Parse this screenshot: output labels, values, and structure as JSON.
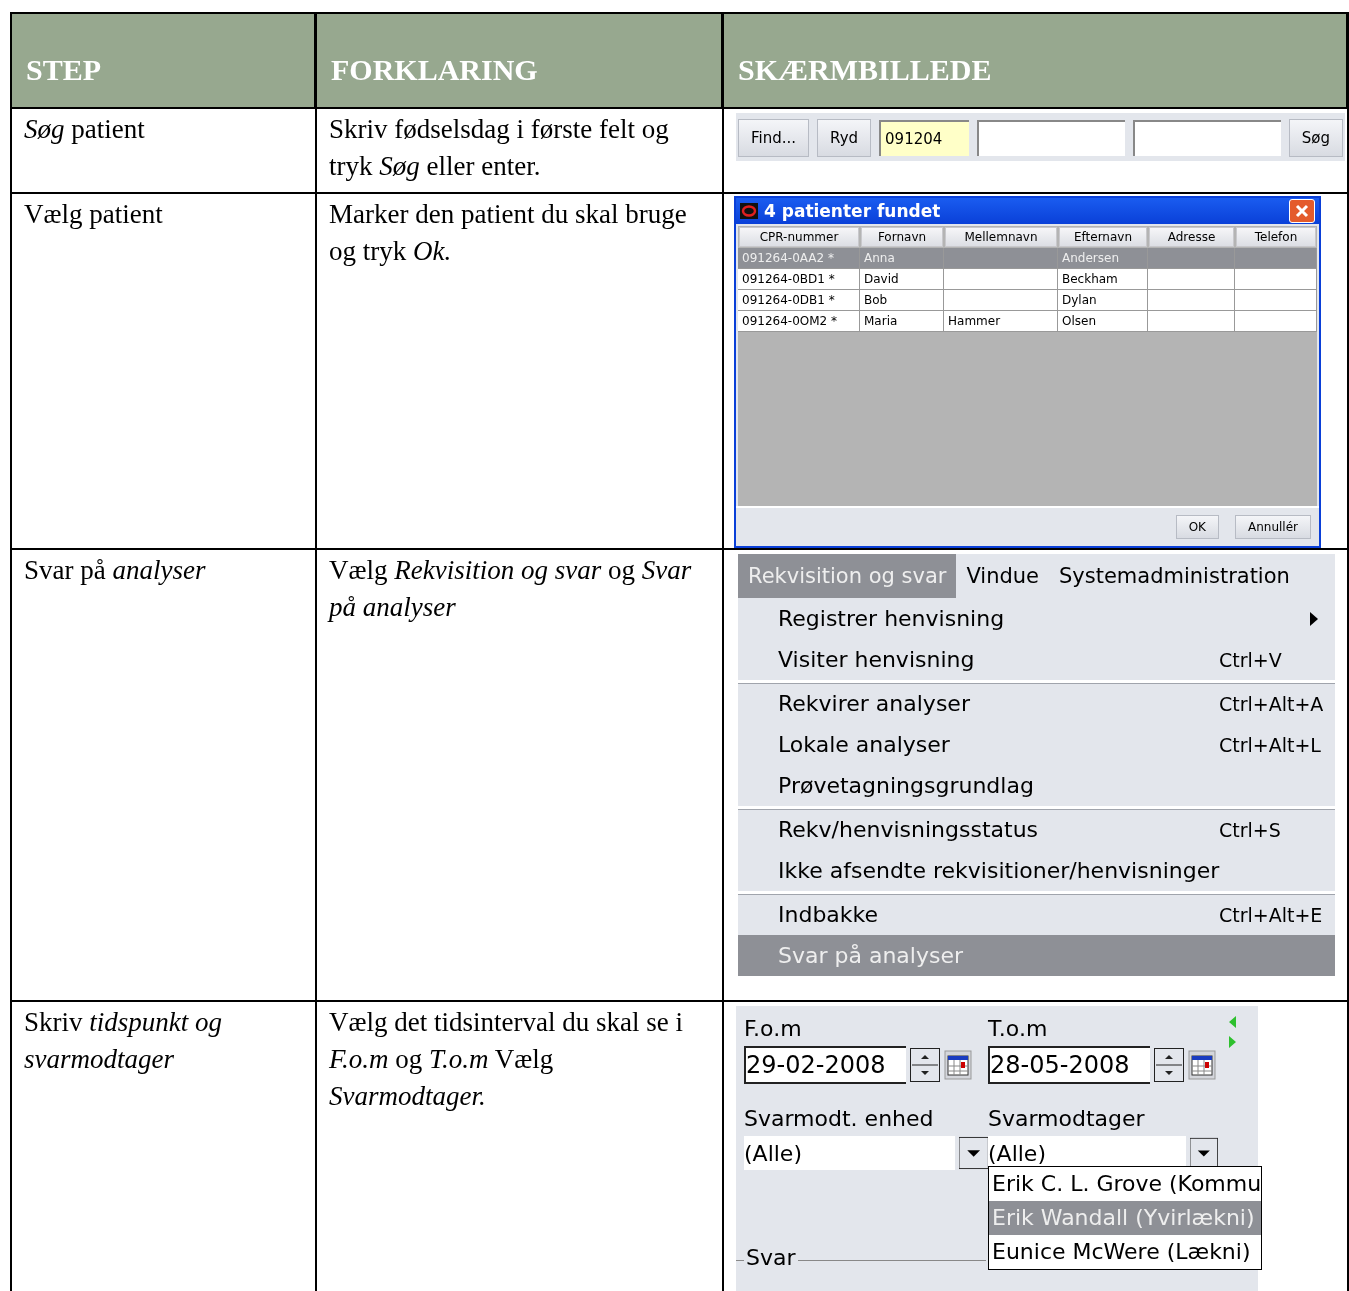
{
  "table": {
    "columns": [
      "STEP",
      "FORKLARING",
      "SKÆRMBILLEDE"
    ],
    "rows": [
      {
        "step": "*Søg* patient",
        "explanation": "Skriv fødselsdag i første felt og tryk *Søg* eller enter.",
        "screen": {
          "kind": "search",
          "buttons": [
            "Find...",
            "Ryd"
          ],
          "fields": [
            {
              "value": "091204",
              "focused": true
            },
            {
              "focused": false
            },
            {
              "focused": false
            }
          ],
          "submit": "Søg"
        }
      },
      {
        "step": "Vælg patient",
        "explanation": "Marker den patient du skal bruge og tryk *Ok.*",
        "screen": {
          "kind": "dialog",
          "title": "4 patienter fundet",
          "columns": [
            "CPR-nummer",
            "Fornavn",
            "Mellemnavn",
            "Efternavn",
            "Adresse",
            "Telefon"
          ],
          "rows": [
            {
              "cells": [
                "091264-0AA2 *",
                "Anna",
                null,
                "Andersen",
                null,
                null
              ],
              "selected": true
            },
            {
              "cells": [
                "091264-0BD1 *",
                "David",
                null,
                "Beckham",
                null,
                null
              ],
              "selected": false
            },
            {
              "cells": [
                "091264-0DB1 *",
                "Bob",
                null,
                "Dylan",
                null,
                null
              ],
              "selected": false
            },
            {
              "cells": [
                "091264-0OM2 *",
                "Maria",
                "Hammer",
                "Olsen",
                null,
                null
              ],
              "selected": false
            }
          ],
          "buttons": [
            "OK",
            "Annullér"
          ]
        }
      },
      {
        "step": "Svar på *analyser*",
        "explanation": "Vælg *Rekvisition og svar* og *Svar på analyser*",
        "screen": {
          "kind": "menu",
          "menubar": [
            {
              "label": "Rekvisition og svar",
              "selected": true
            },
            {
              "label": "Vindue",
              "selected": false
            },
            {
              "label": "Systemadministration",
              "selected": false
            }
          ],
          "items": [
            {
              "label": "Registrer henvisning",
              "submenu": true,
              "separator_before": false,
              "selected": false
            },
            {
              "label": "Visiter henvisning",
              "shortcut": "Ctrl+V",
              "submenu": false,
              "separator_before": false,
              "selected": false
            },
            {
              "label": "Rekvirer analyser",
              "shortcut": "Ctrl+Alt+A",
              "submenu": false,
              "separator_before": true,
              "selected": false
            },
            {
              "label": "Lokale analyser",
              "shortcut": "Ctrl+Alt+L",
              "submenu": false,
              "separator_before": false,
              "selected": false
            },
            {
              "label": "Prøvetagningsgrundlag",
              "submenu": false,
              "separator_before": false,
              "selected": false
            },
            {
              "label": "Rekv/henvisningsstatus",
              "shortcut": "Ctrl+S",
              "submenu": false,
              "separator_before": true,
              "selected": false
            },
            {
              "label": "Ikke afsendte rekvisitioner/henvisninger",
              "submenu": false,
              "separator_before": false,
              "selected": false
            },
            {
              "label": "Indbakke",
              "shortcut": "Ctrl+Alt+E",
              "submenu": false,
              "separator_before": true,
              "selected": false
            },
            {
              "label": "Svar på analyser",
              "submenu": false,
              "separator_before": false,
              "selected": true
            }
          ]
        }
      },
      {
        "step": "Skriv *tidspunkt og svarmodtager*",
        "explanation": "Vælg det tidsinterval du skal se i *F.o.m* og *T.o.m* Vælg *Svarmodtager.*",
        "screen": {
          "kind": "form",
          "dates": [
            {
              "label": "F.o.m",
              "value": "29-02-2008"
            },
            {
              "label": "T.o.m",
              "value": "28-05-2008"
            }
          ],
          "combos": [
            {
              "label": "Svarmodt. enhed",
              "value": "(Alle)"
            },
            {
              "label": "Svarmodtager",
              "value": "(Alle)"
            }
          ],
          "options": [
            {
              "label": "Erik C. L. Grove (Kommu",
              "selected": false
            },
            {
              "label": "Erik Wandall (Yvirlækni)",
              "selected": true
            },
            {
              "label": "Eunice McWere (Lækni)",
              "selected": false
            }
          ],
          "group": "Svar"
        }
      }
    ]
  }
}
